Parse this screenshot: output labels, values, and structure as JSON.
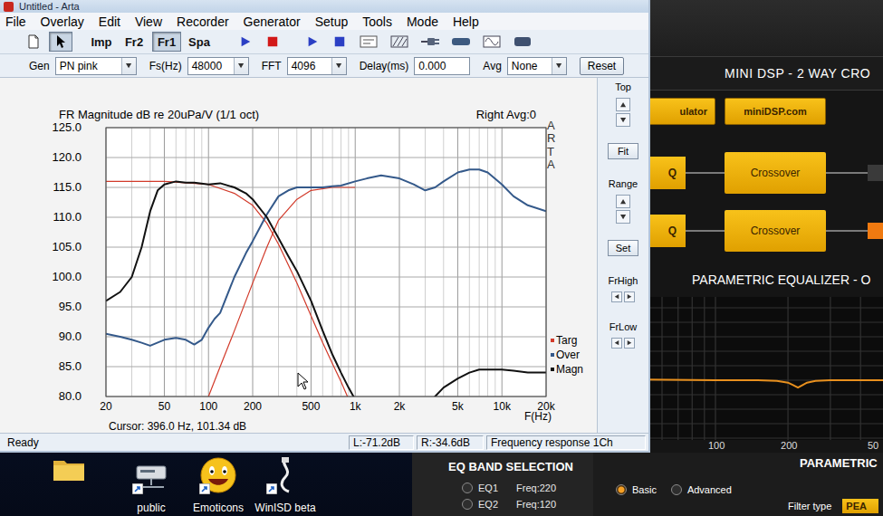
{
  "arta": {
    "title": "Untitled - Arta",
    "menu": [
      "File",
      "Overlay",
      "Edit",
      "View",
      "Recorder",
      "Generator",
      "Setup",
      "Tools",
      "Mode",
      "Help"
    ],
    "toolbar": {
      "tools": [
        {
          "selected": false
        },
        {
          "selected": true
        }
      ],
      "modes": [
        {
          "label": "Imp",
          "selected": false
        },
        {
          "label": "Fr2",
          "selected": false
        },
        {
          "label": "Fr1",
          "selected": true
        },
        {
          "label": "Spa",
          "selected": false
        }
      ]
    },
    "controls": [
      {
        "label": "Gen",
        "kind": "select",
        "value": "PN pink"
      },
      {
        "label": "Fs(Hz)",
        "kind": "select",
        "value": "48000"
      },
      {
        "label": "FFT",
        "kind": "select",
        "value": "4096"
      },
      {
        "label": "Delay(ms)",
        "kind": "input",
        "value": "0.000"
      },
      {
        "label": "Avg",
        "kind": "select",
        "value": "None"
      }
    ],
    "reset_button": "Reset",
    "chart": {
      "title": "FR Magnitude dB re 20uPa/V (1/1 oct)",
      "channel": "Right Avg:0",
      "brand": "ARTA",
      "x_label": "F(Hz)",
      "cursor": "Cursor: 396.0 Hz, 101.34 dB",
      "y_ticks": [
        {
          "label": "125.0",
          "value": 125
        },
        {
          "label": "120.0",
          "value": 120
        },
        {
          "label": "115.0",
          "value": 115
        },
        {
          "label": "110.0",
          "value": 110
        },
        {
          "label": "105.0",
          "value": 105
        },
        {
          "label": "100.0",
          "value": 100
        },
        {
          "label": "95.0",
          "value": 95
        },
        {
          "label": "90.0",
          "value": 90
        },
        {
          "label": "85.0",
          "value": 85
        },
        {
          "label": "80.0",
          "value": 80
        }
      ],
      "x_ticks": [
        {
          "label": "20",
          "value": 20
        },
        {
          "label": "50",
          "value": 50
        },
        {
          "label": "100",
          "value": 100
        },
        {
          "label": "200",
          "value": 200
        },
        {
          "label": "500",
          "value": 500
        },
        {
          "label": "1k",
          "value": 1000
        },
        {
          "label": "2k",
          "value": 2000
        },
        {
          "label": "5k",
          "value": 5000
        },
        {
          "label": "10k",
          "value": 10000
        },
        {
          "label": "20k",
          "value": 20000
        }
      ],
      "series": [
        {
          "name": "Targ",
          "color": "#d23a2a",
          "curves": [
            {
              "freqs": [
                20,
                25,
                30,
                40,
                50,
                100,
                150,
                200,
                250,
                300,
                400,
                500,
                600,
                700,
                800,
                1000
              ],
              "values": [
                116,
                116,
                116,
                116,
                116,
                115.5,
                114,
                112,
                109,
                105.5,
                99,
                93.5,
                89,
                85.5,
                82.5,
                77
              ]
            },
            {
              "freqs": [
                100,
                120,
                150,
                200,
                250,
                300,
                400,
                500,
                700,
                1000
              ],
              "values": [
                80,
                85,
                91,
                99,
                105,
                109.5,
                113,
                114.5,
                115,
                115
              ]
            }
          ]
        },
        {
          "name": "Over",
          "color": "#34598a",
          "curves": [
            {
              "freqs": [
                20,
                25,
                30,
                35,
                40,
                50,
                60,
                70,
                80,
                90,
                100,
                110,
                120,
                150,
                180,
                200,
                250,
                300,
                350,
                400,
                500,
                600,
                700,
                800,
                1000,
                1200,
                1500,
                2000,
                2500,
                3000,
                3500,
                4000,
                5000,
                6000,
                7000,
                8000,
                10000,
                12000,
                15000,
                20000
              ],
              "values": [
                90.5,
                90,
                89.5,
                89,
                88.5,
                89.5,
                89.8,
                89.5,
                88.7,
                89.5,
                91.5,
                93,
                94,
                100,
                104,
                106,
                110.5,
                113.5,
                114.5,
                115,
                115,
                115,
                115.2,
                115.3,
                116,
                116.5,
                117,
                116.5,
                115.5,
                114.5,
                115,
                116,
                117.5,
                118,
                118,
                117.5,
                115.5,
                113.5,
                112,
                111
              ]
            }
          ]
        },
        {
          "name": "Magn",
          "color": "#111111",
          "curves": [
            {
              "freqs": [
                20,
                25,
                30,
                35,
                40,
                45,
                50,
                60,
                70,
                80,
                100,
                120,
                150,
                180,
                200,
                250,
                300,
                350,
                400,
                500,
                600,
                700,
                800,
                900,
                1000,
                1100
              ],
              "values": [
                96,
                97.5,
                100,
                105,
                111,
                114.5,
                115.5,
                116,
                115.8,
                115.8,
                115.5,
                115.7,
                115,
                114,
                113,
                110,
                106.5,
                103.5,
                101,
                96,
                91,
                87,
                84,
                81.5,
                79.5,
                78
              ]
            },
            {
              "freqs": [
                2500,
                3000,
                3500,
                4000,
                5000,
                6000,
                7000,
                8000,
                10000,
                12000,
                15000,
                20000
              ],
              "values": [
                77,
                78.5,
                80,
                81.5,
                83,
                84,
                84.5,
                84.5,
                84.5,
                84.3,
                84,
                84
              ]
            }
          ]
        }
      ]
    },
    "side_panel": [
      {
        "kind": "label",
        "text": "Top"
      },
      {
        "kind": "spin"
      },
      {
        "kind": "button",
        "text": "Fit"
      },
      {
        "kind": "label",
        "text": "Range"
      },
      {
        "kind": "spin"
      },
      {
        "kind": "button",
        "text": "Set"
      },
      {
        "kind": "label",
        "text": "FrHigh"
      },
      {
        "kind": "arrows"
      },
      {
        "kind": "label",
        "text": "FrLow"
      },
      {
        "kind": "arrows"
      }
    ],
    "status_bar": [
      "Ready",
      "L:-71.2dB",
      "R:-34.6dB",
      "Frequency response 1Ch"
    ]
  },
  "minidsp": {
    "title": "MINI DSP - 2 WAY CRO",
    "buttons": [
      "ulator",
      "miniDSP.com"
    ],
    "routes": [
      {
        "input": "Q",
        "block": "Crossover",
        "active": false
      },
      {
        "input": "Q",
        "block": "Crossover",
        "active": true
      }
    ],
    "eq_title": "PARAMETRIC EQUALIZER - O",
    "eq_graph": {
      "x_ticks": [
        {
          "label": "100",
          "value": 100
        },
        {
          "label": "200",
          "value": 200
        },
        {
          "label": "50",
          "value": 500
        }
      ],
      "curve": {
        "freqs": [
          30,
          50,
          80,
          100,
          150,
          180,
          200,
          210,
          220,
          230,
          240,
          260,
          300,
          400,
          600,
          900
        ],
        "values": [
          0.6,
          0.3,
          0.1,
          0,
          0,
          -0.3,
          -1,
          -2,
          -3,
          -2,
          -1,
          -0.3,
          0,
          0,
          0,
          0
        ]
      }
    },
    "band_selection": {
      "title": "EQ BAND SELECTION",
      "bands": [
        {
          "name": "EQ1",
          "freq": "Freq:220",
          "selected": false
        },
        {
          "name": "EQ2",
          "freq": "Freq:120",
          "selected": false
        }
      ]
    },
    "parametric": {
      "title": "PARAMETRIC",
      "modes": [
        {
          "label": "Basic",
          "selected": true
        },
        {
          "label": "Advanced",
          "selected": false
        }
      ],
      "filter_type_label": "Filter type",
      "filter_type": "PEA"
    }
  },
  "desktop_icons": [
    {
      "label": "public"
    },
    {
      "label": "Emoticons"
    },
    {
      "label": "WinISD beta"
    }
  ]
}
